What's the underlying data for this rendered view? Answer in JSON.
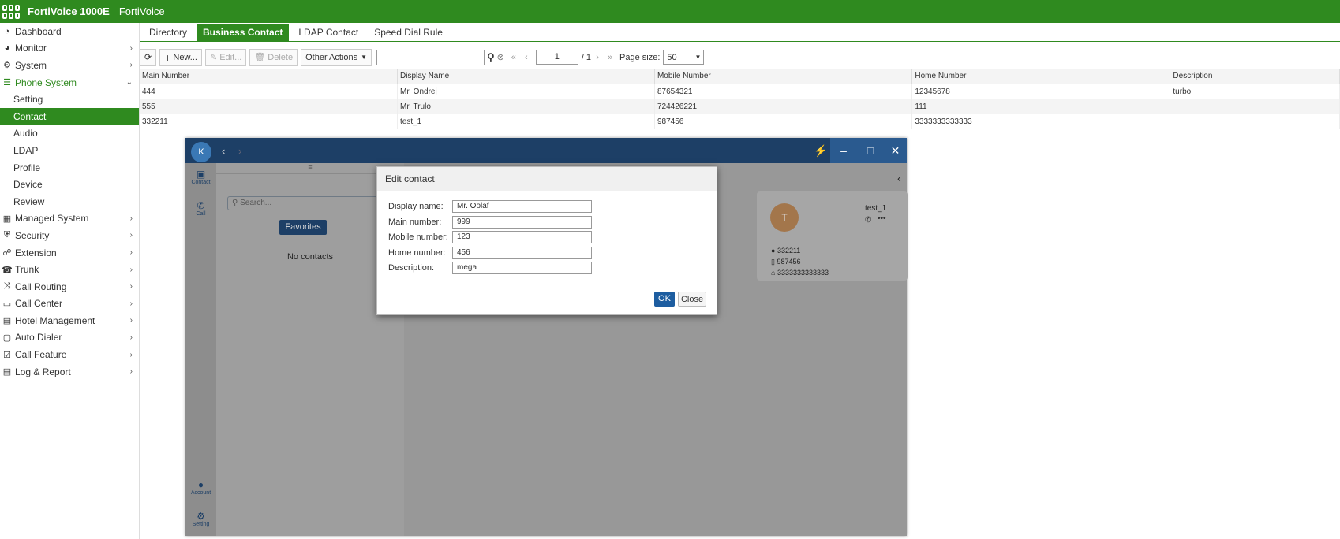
{
  "header": {
    "product": "FortiVoice 1000E",
    "brand": "FortiVoice"
  },
  "sidebar": {
    "items": [
      {
        "label": "Dashboard",
        "icon": "dashboard-icon",
        "glyph": "◔",
        "chevron": false,
        "level": 0,
        "state": "normal"
      },
      {
        "label": "Monitor",
        "icon": "monitor-icon",
        "glyph": "◕",
        "chevron": true,
        "level": 0,
        "state": "normal"
      },
      {
        "label": "System",
        "icon": "gear-icon",
        "glyph": "⚙",
        "chevron": true,
        "level": 0,
        "state": "normal"
      },
      {
        "label": "Phone System",
        "icon": "phone-system-icon",
        "glyph": "☰",
        "chevron": true,
        "level": 0,
        "state": "open"
      },
      {
        "label": "Setting",
        "level": 1,
        "state": "normal"
      },
      {
        "label": "Contact",
        "level": 1,
        "state": "active"
      },
      {
        "label": "Audio",
        "level": 1,
        "state": "normal"
      },
      {
        "label": "LDAP",
        "level": 1,
        "state": "normal"
      },
      {
        "label": "Profile",
        "level": 1,
        "state": "normal"
      },
      {
        "label": "Device",
        "level": 1,
        "state": "normal"
      },
      {
        "label": "Review",
        "level": 1,
        "state": "normal"
      },
      {
        "label": "Managed System",
        "icon": "managed-system-icon",
        "glyph": "▦",
        "chevron": true,
        "level": 0,
        "state": "normal"
      },
      {
        "label": "Security",
        "icon": "shield-icon",
        "glyph": "⛨",
        "chevron": true,
        "level": 0,
        "state": "normal"
      },
      {
        "label": "Extension",
        "icon": "extension-icon",
        "glyph": "☍",
        "chevron": true,
        "level": 0,
        "state": "normal"
      },
      {
        "label": "Trunk",
        "icon": "trunk-icon",
        "glyph": "☎",
        "chevron": true,
        "level": 0,
        "state": "normal"
      },
      {
        "label": "Call Routing",
        "icon": "shuffle-icon",
        "glyph": "⤨",
        "chevron": true,
        "level": 0,
        "state": "normal"
      },
      {
        "label": "Call Center",
        "icon": "call-center-icon",
        "glyph": "▭",
        "chevron": true,
        "level": 0,
        "state": "normal"
      },
      {
        "label": "Hotel Management",
        "icon": "hotel-icon",
        "glyph": "▤",
        "chevron": true,
        "level": 0,
        "state": "normal"
      },
      {
        "label": "Auto Dialer",
        "icon": "auto-dialer-icon",
        "glyph": "▢",
        "chevron": true,
        "level": 0,
        "state": "normal"
      },
      {
        "label": "Call Feature",
        "icon": "call-feature-icon",
        "glyph": "☑",
        "chevron": true,
        "level": 0,
        "state": "normal"
      },
      {
        "label": "Log & Report",
        "icon": "log-icon",
        "glyph": "▤",
        "chevron": true,
        "level": 0,
        "state": "normal"
      }
    ]
  },
  "tabs": [
    {
      "label": "Directory",
      "active": false
    },
    {
      "label": "Business Contact",
      "active": true
    },
    {
      "label": "LDAP Contact",
      "active": false
    },
    {
      "label": "Speed Dial Rule",
      "active": false
    }
  ],
  "toolbar": {
    "new_label": "New...",
    "edit_label": "Edit...",
    "delete_label": "Delete",
    "other_actions_label": "Other Actions",
    "search_value": "",
    "page_current": "1",
    "page_total": "/ 1",
    "page_size_label": "Page size:",
    "page_size_value": "50"
  },
  "table": {
    "columns": [
      "Main Number",
      "Display Name",
      "Mobile Number",
      "Home Number",
      "Description"
    ],
    "rows": [
      [
        "444",
        "Mr. Ondrej",
        "87654321",
        "12345678",
        "turbo"
      ],
      [
        "555",
        "Mr. Trulo",
        "724426221",
        "111",
        ""
      ],
      [
        "332211",
        "test_1",
        "987456",
        "3333333333333",
        ""
      ]
    ]
  },
  "app": {
    "avatar_letter": "K",
    "rail": {
      "contact_label": "Contact",
      "call_label": "Call",
      "account_label": "Account",
      "setting_label": "Setting"
    },
    "search_placeholder": "Search...",
    "favorites_label": "Favorites",
    "no_contacts_label": "No contacts",
    "card": {
      "avatar_letter": "T",
      "name": "test_1",
      "main_number": "332211",
      "mobile_number": "987456",
      "home_number": "3333333333333"
    }
  },
  "dialog": {
    "title": "Edit contact",
    "fields": [
      {
        "label": "Display name:",
        "value": "Mr. Oolaf"
      },
      {
        "label": "Main number:",
        "value": "999"
      },
      {
        "label": "Mobile number:",
        "value": "123"
      },
      {
        "label": "Home number:",
        "value": "456"
      },
      {
        "label": "Description:",
        "value": "mega"
      }
    ],
    "ok_label": "OK",
    "close_label": "Close"
  },
  "colors": {
    "brand_green": "#2f8a1f",
    "app_navy": "#1d3f66",
    "ok_blue": "#1d5da0"
  }
}
